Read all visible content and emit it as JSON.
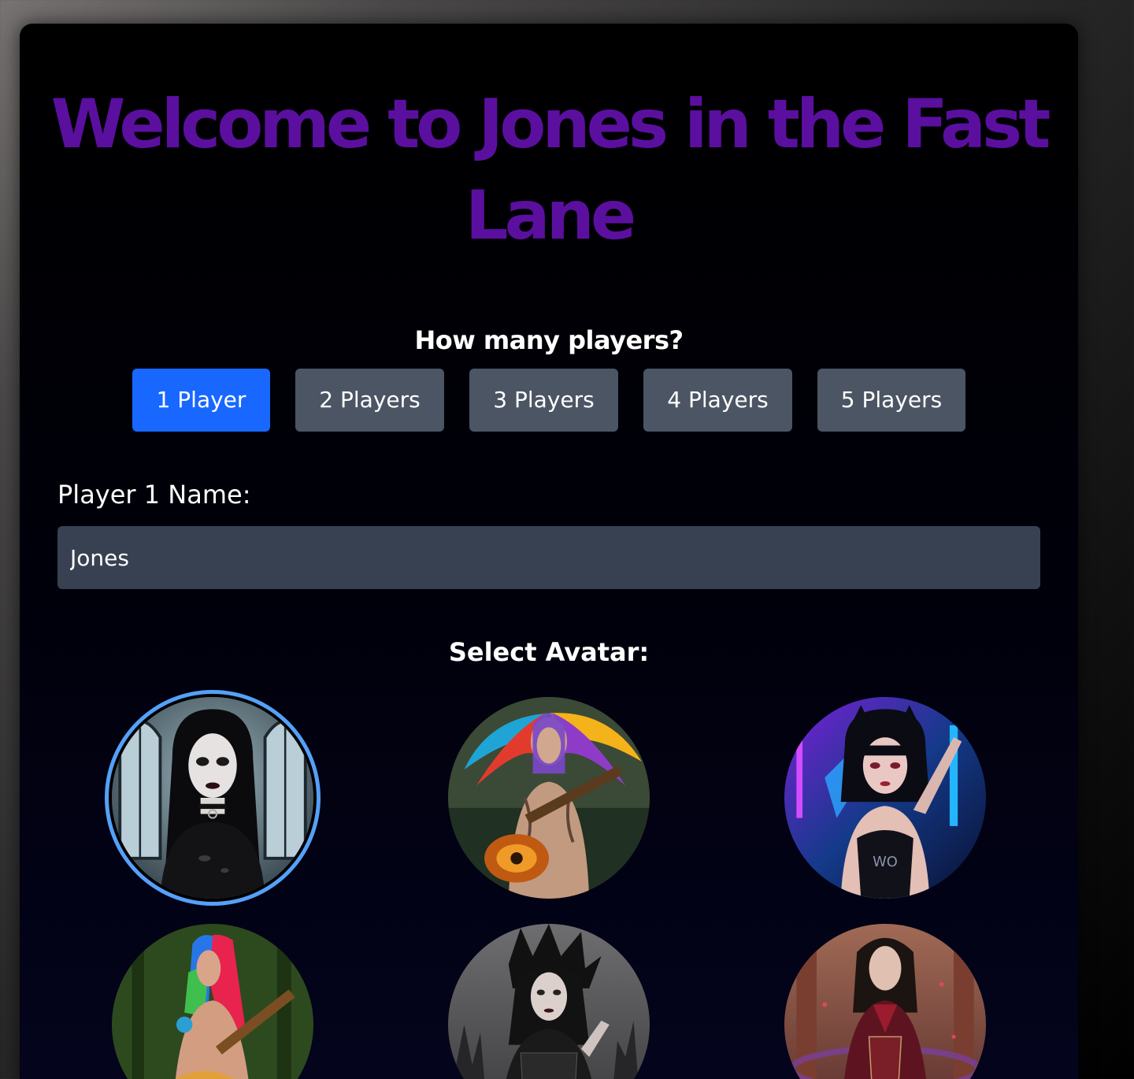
{
  "title": "Welcome to Jones in the Fast Lane",
  "players_heading": "How many players?",
  "player_buttons": [
    {
      "label": "1 Player",
      "selected": true
    },
    {
      "label": "2 Players",
      "selected": false
    },
    {
      "label": "3 Players",
      "selected": false
    },
    {
      "label": "4 Players",
      "selected": false
    },
    {
      "label": "5 Players",
      "selected": false
    }
  ],
  "name_field": {
    "label": "Player 1 Name:",
    "value": "Jones"
  },
  "avatar_heading": "Select Avatar:",
  "avatars": [
    {
      "icon": "goth-girl-avatar",
      "selected": true
    },
    {
      "icon": "rainbow-hair-guitarist-avatar",
      "selected": false
    },
    {
      "icon": "neon-punk-girl-avatar",
      "selected": false
    },
    {
      "icon": "rainbow-hair-girl-guitarist-avatar",
      "selected": false
    },
    {
      "icon": "spiked-hair-goth-avatar",
      "selected": false
    },
    {
      "icon": "vampire-avatar",
      "selected": false
    }
  ],
  "colors": {
    "title": "#5b0f9f",
    "button_active": "#1868ff",
    "button_inactive": "#4b5563",
    "input_bg": "#374151",
    "selected_ring": "#55a0f8"
  }
}
